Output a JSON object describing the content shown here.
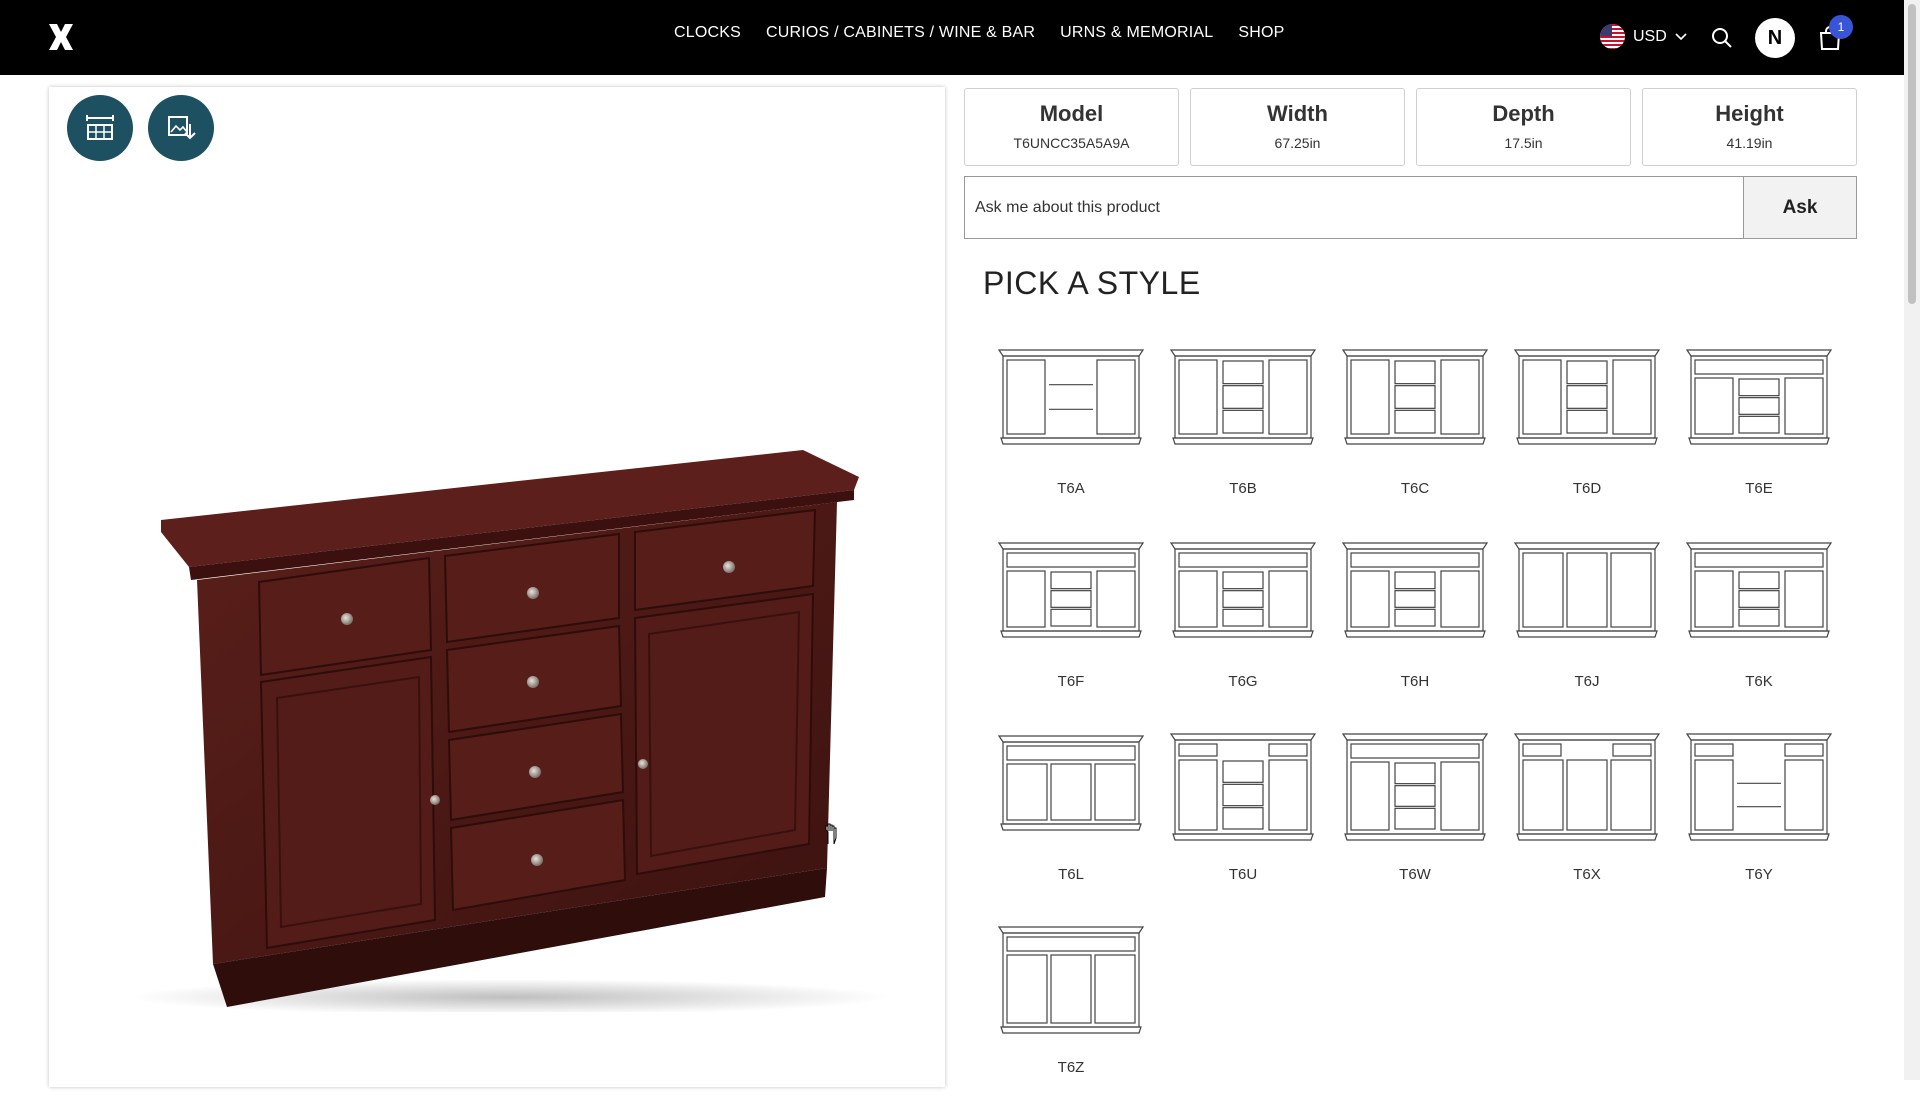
{
  "nav": {
    "links": [
      "CLOCKS",
      "CURIOS / CABINETS / WINE & BAR",
      "URNS & MEMORIAL",
      "SHOP"
    ],
    "currency": "USD",
    "avatar_initial": "N",
    "cart_count": "1"
  },
  "specs": [
    {
      "label": "Model",
      "value": "T6UNCC35A5A9A"
    },
    {
      "label": "Width",
      "value": "67.25in"
    },
    {
      "label": "Depth",
      "value": "17.5in"
    },
    {
      "label": "Height",
      "value": "41.19in"
    }
  ],
  "ask": {
    "placeholder": "Ask me about this product",
    "button": "Ask"
  },
  "section_title": "PICK A STYLE",
  "styles": [
    {
      "label": "T6A",
      "variant": "doors-shelves"
    },
    {
      "label": "T6B",
      "variant": "doors-shelves-drawer"
    },
    {
      "label": "T6C",
      "variant": "doors-3drawers"
    },
    {
      "label": "T6D",
      "variant": "doors-4drawers"
    },
    {
      "label": "T6E",
      "variant": "topdrawers-shelves"
    },
    {
      "label": "T6F",
      "variant": "topdrawers-shelves"
    },
    {
      "label": "T6G",
      "variant": "topdrawers-drawers"
    },
    {
      "label": "T6H",
      "variant": "topdrawers-drawers"
    },
    {
      "label": "T6J",
      "variant": "three-doors"
    },
    {
      "label": "T6K",
      "variant": "open-top-drawers"
    },
    {
      "label": "T6L",
      "variant": "open-top-doors"
    },
    {
      "label": "T6U",
      "variant": "tall-drawers"
    },
    {
      "label": "T6W",
      "variant": "tall-open-drawers"
    },
    {
      "label": "T6X",
      "variant": "tall-three-doors"
    },
    {
      "label": "T6Y",
      "variant": "tall-shelves"
    },
    {
      "label": "T6Z",
      "variant": "tall-open-three-doors"
    }
  ],
  "colors": {
    "nav_bg": "#000000",
    "button_teal": "#1d5061",
    "badge_blue": "#3a54d6",
    "wood": "#4a1a16"
  }
}
